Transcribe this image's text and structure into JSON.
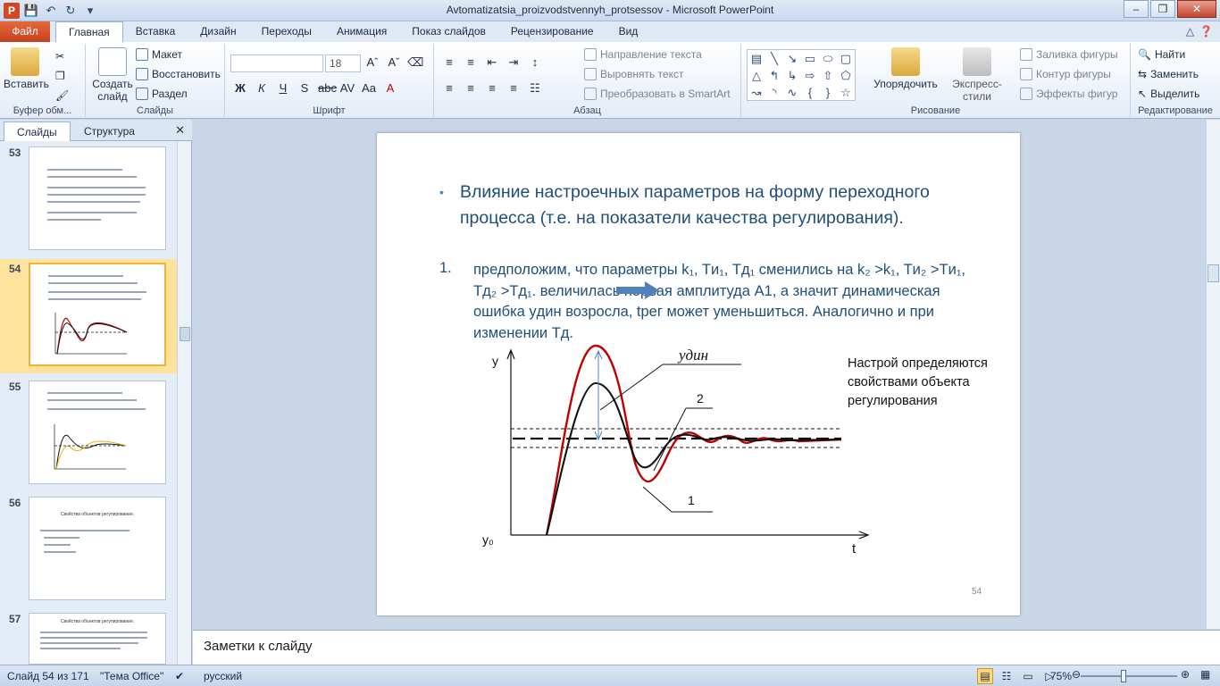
{
  "window": {
    "title": "Avtomatizatsia_proizvodstvennyh_protsessov - Microsoft PowerPoint",
    "app_icon": "P"
  },
  "ribbon_tabs": {
    "file": "Файл",
    "tabs": [
      "Главная",
      "Вставка",
      "Дизайн",
      "Переходы",
      "Анимация",
      "Показ слайдов",
      "Рецензирование",
      "Вид"
    ]
  },
  "ribbon": {
    "clipboard": {
      "paste": "Вставить",
      "label": "Буфер обм..."
    },
    "slides": {
      "new_slide": "Создать слайд",
      "layout": "Макет",
      "reset": "Восстановить",
      "section": "Раздел",
      "label": "Слайды"
    },
    "font": {
      "size": "18",
      "label": "Шрифт"
    },
    "paragraph": {
      "text_direction": "Направление текста",
      "align_text": "Выровнять текст",
      "smartart": "Преобразовать в SmartArt",
      "label": "Абзац"
    },
    "drawing": {
      "arrange": "Упорядочить",
      "quick_styles": "Экспресс-стили",
      "fill": "Заливка фигуры",
      "outline": "Контур фигуры",
      "effects": "Эффекты фигур",
      "label": "Рисование"
    },
    "editing": {
      "find": "Найти",
      "replace": "Заменить",
      "select": "Выделить",
      "label": "Редактирование"
    }
  },
  "left_panel": {
    "tab_slides": "Слайды",
    "tab_outline": "Структура",
    "thumbs": [
      {
        "num": "53"
      },
      {
        "num": "54"
      },
      {
        "num": "55"
      },
      {
        "num": "56",
        "title": "Свойства объектов регулирования."
      },
      {
        "num": "57",
        "title": "Свойства объектов регулирования."
      }
    ]
  },
  "slide": {
    "title": "Влияние настроечных параметров на форму переходного процесса (т.е. на показатели качества регулирования).",
    "item_number": "1.",
    "body": "предположим, что параметры k₁, Tи₁, Tд₁ сменились на k₂ >k₁, Tи₂ >Tи₁, Tд₂ >Tд₁.        величилась первая амплитуда А1, а значит динамическая ошибка yдин возросла, tрег может уменьшиться. Аналогично и при изменении Tд.",
    "note": "Настрой определяются свойствами объекта регулирования",
    "number": "54",
    "labels": {
      "y": "y",
      "y0": "y₀",
      "t": "t",
      "ydin": "yдин",
      "curve2": "2",
      "curve1": "1"
    }
  },
  "notes": {
    "placeholder": "Заметки к слайду"
  },
  "statusbar": {
    "slide_info": "Слайд 54 из 171",
    "theme": "\"Тема Office\"",
    "language": "русский",
    "zoom": "75%"
  },
  "colors": {
    "accent": "#c8401e",
    "curve_red": "#c00000",
    "title_blue": "#1f4e79",
    "arrow_blue": "#4f81bd"
  }
}
